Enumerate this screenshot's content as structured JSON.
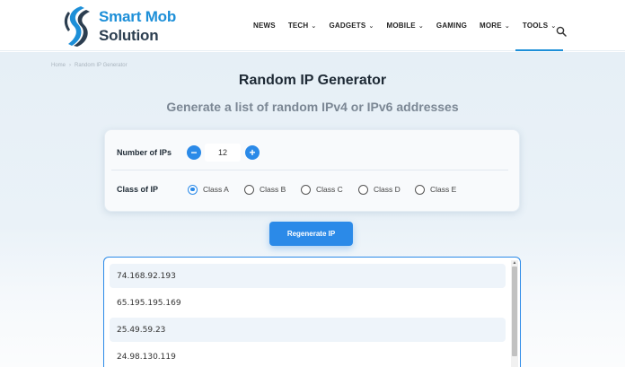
{
  "brand": {
    "line1": "Smart Mob",
    "line2": "Solution",
    "accent_color": "#1d8fd8",
    "dark_color": "#2c3e50"
  },
  "nav": {
    "items": [
      {
        "label": "NEWS",
        "dropdown": false
      },
      {
        "label": "TECH",
        "dropdown": true
      },
      {
        "label": "GADGETS",
        "dropdown": true
      },
      {
        "label": "MOBILE",
        "dropdown": true
      },
      {
        "label": "GAMING",
        "dropdown": false
      },
      {
        "label": "MORE",
        "dropdown": true
      },
      {
        "label": "TOOLS",
        "dropdown": true,
        "active": true
      }
    ],
    "search_icon": "search-icon"
  },
  "breadcrumb": {
    "home": "Home",
    "separator": "›",
    "current": "Random IP Generator"
  },
  "page": {
    "title": "Random IP Generator",
    "subtitle": "Generate a list of random IPv4 or IPv6 addresses"
  },
  "options": {
    "count_label": "Number of IPs",
    "count_value": "12",
    "decrement_icon": "minus-icon",
    "increment_icon": "plus-icon",
    "class_label": "Class of IP",
    "classes": [
      {
        "label": "Class A",
        "checked": true
      },
      {
        "label": "Class B",
        "checked": false
      },
      {
        "label": "Class C",
        "checked": false
      },
      {
        "label": "Class D",
        "checked": false
      },
      {
        "label": "Class E",
        "checked": false
      }
    ],
    "primary_color": "#2b8ae8"
  },
  "regenerate_label": "Regenerate IP",
  "results": [
    "74.168.92.193",
    "65.195.195.169",
    "25.49.59.23",
    "24.98.130.119"
  ]
}
